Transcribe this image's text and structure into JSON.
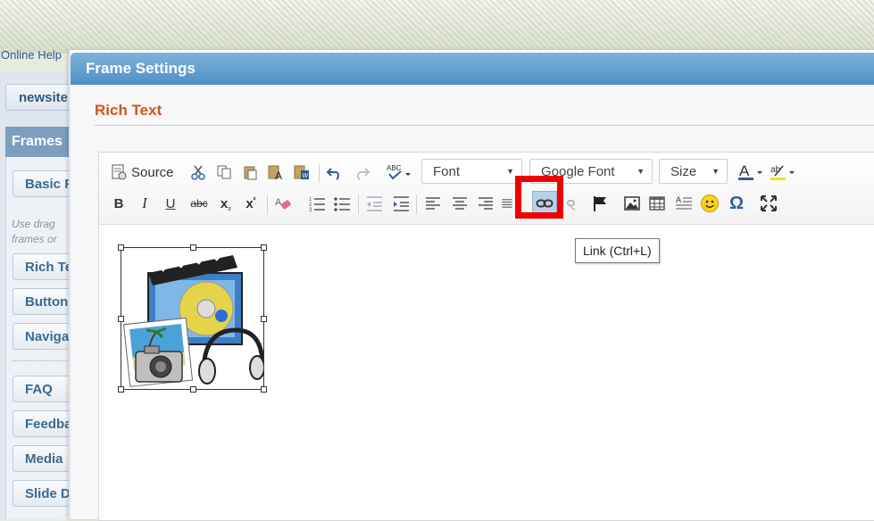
{
  "background": {
    "online_help": "Online Help",
    "sidebar": {
      "top_button": "newsite",
      "section_header": "Frames",
      "basic": "Basic Frames",
      "hint_line1": "Use drag",
      "hint_line2": "frames or",
      "items_group1": [
        "Rich Text",
        "Buttons",
        "Navigation"
      ],
      "items_group2": [
        "FAQ",
        "Feedback",
        "Media",
        "Slide Deck"
      ]
    }
  },
  "dialog": {
    "title": "Frame Settings",
    "section_title": "Rich Text"
  },
  "toolbar": {
    "source_label": "Source",
    "font_combo": "Font",
    "google_font_combo": "Google Font",
    "size_combo": "Size",
    "bold": "B",
    "italic": "I",
    "underline": "U",
    "strike": "abc",
    "subscript": "x",
    "superscript": "x",
    "link_tooltip": "Link (Ctrl+L)"
  },
  "colors": {
    "highlight_box": "#f20000",
    "section_title": "#d2561a",
    "dialog_title_bar": "#5a97cb"
  }
}
